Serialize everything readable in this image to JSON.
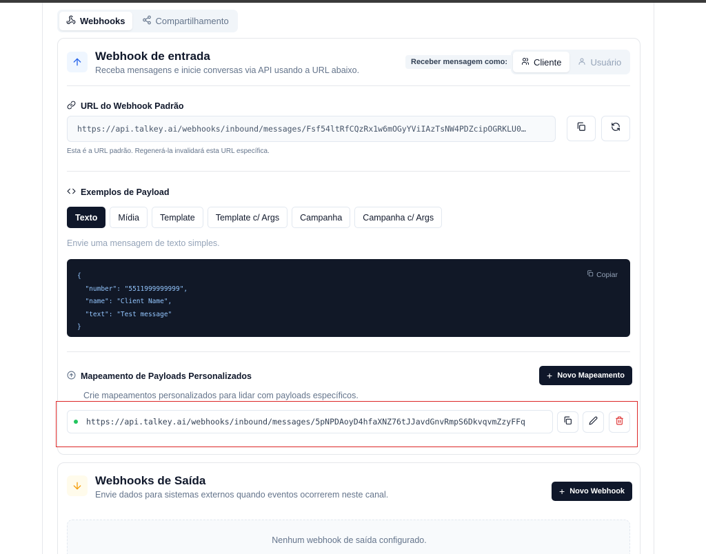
{
  "tabs": [
    {
      "label": "Webhooks",
      "icon": "webhook-icon",
      "active": true
    },
    {
      "label": "Compartilhamento",
      "icon": "share-icon",
      "active": false
    }
  ],
  "incoming": {
    "title": "Webhook de entrada",
    "subtitle": "Receba mensagens e inicie conversas via API usando a URL abaixo.",
    "receive_label": "Receber mensagem como:",
    "receive_options": [
      {
        "label": "Cliente",
        "active": true
      },
      {
        "label": "Usuário",
        "active": false
      }
    ],
    "url_section_label": "URL do Webhook Padrão",
    "default_url": "https://api.talkey.ai/webhooks/inbound/messages/Fsf54ltRfCQzRx1w6mOGyYViIAzTsNW4PDZcipOGRKLU0…",
    "url_hint": "Esta é a URL padrão. Regenerá-la invalidará esta URL específica."
  },
  "payload": {
    "section_label": "Exemplos de Payload",
    "tabs": [
      "Texto",
      "Mídia",
      "Template",
      "Template c/ Args",
      "Campanha",
      "Campanha c/ Args"
    ],
    "active_tab": "Texto",
    "description": "Envie uma mensagem de texto simples.",
    "copy_label": "Copiar",
    "code_lines": [
      "{",
      "  \"number\": \"5511999999999\",",
      "  \"name\": \"Client Name\",",
      "  \"text\": \"Test message\"",
      "}"
    ]
  },
  "mapping": {
    "section_label": "Mapeamento de Payloads Personalizados",
    "new_button": "Novo Mapeamento",
    "description": "Crie mapeamentos personalizados para lidar com payloads específicos.",
    "items": [
      {
        "url": "https://api.talkey.ai/webhooks/inbound/messages/5pNPDAoyD4hfaXNZ76tJJavdGnvRmpS6DkvqvmZzyFFq",
        "active": true
      }
    ]
  },
  "outgoing": {
    "title": "Webhooks de Saída",
    "subtitle": "Envie dados para sistemas externos quando eventos ocorrerem neste canal.",
    "new_button": "Novo Webhook",
    "empty_text": "Nenhum webhook de saída configurado."
  },
  "colors": {
    "primary": "#0f172a",
    "accent_blue": "#2563eb",
    "accent_orange": "#f59e0b",
    "status_green": "#22c55e",
    "danger": "#dc2626",
    "code_bg": "#111827"
  }
}
